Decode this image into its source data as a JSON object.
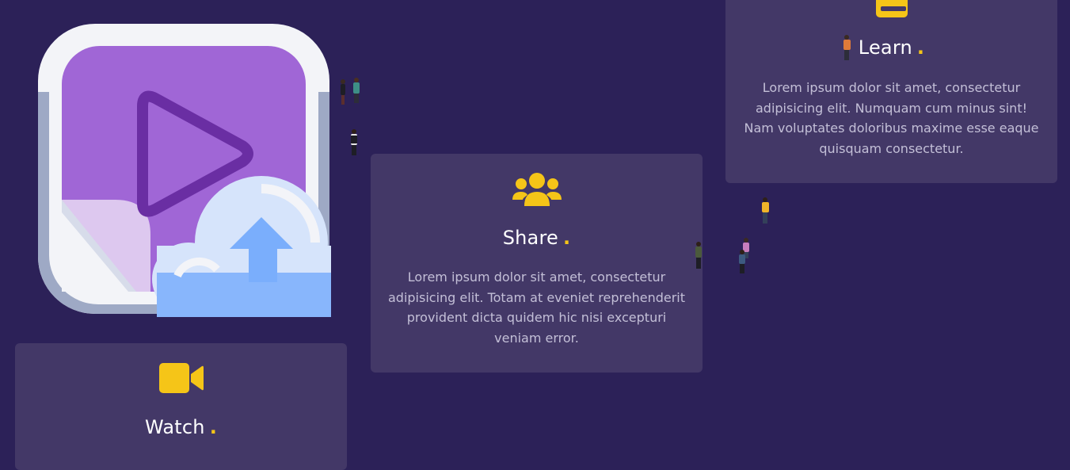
{
  "hero": {
    "illustration": "video-upload-cloud-illustration",
    "colors": {
      "frame": "#f3f4f8",
      "screen": "#a066d6",
      "play": "#6a2ea3",
      "cloud": "#d6e4fb",
      "arrow": "#7aaefc"
    }
  },
  "cards": {
    "learn": {
      "icon": "book-icon",
      "title": "Learn",
      "dot": ".",
      "text": "Lorem ipsum dolor sit amet, consectetur adipisicing elit. Numquam cum minus sint! Nam voluptates doloribus maxime esse eaque quisquam consectetur."
    },
    "share": {
      "icon": "users-icon",
      "title": "Share",
      "dot": ".",
      "text": "Lorem ipsum dolor sit amet, consectetur adipisicing elit. Totam at eveniet reprehenderit provident dicta quidem hic nisi excepturi veniam error."
    },
    "watch": {
      "icon": "video-camera-icon",
      "title": "Watch",
      "dot": "."
    }
  },
  "colors": {
    "background": "#2c2158",
    "card": "#433867",
    "accent": "#f5c518",
    "body_text": "#c3bfd7"
  }
}
